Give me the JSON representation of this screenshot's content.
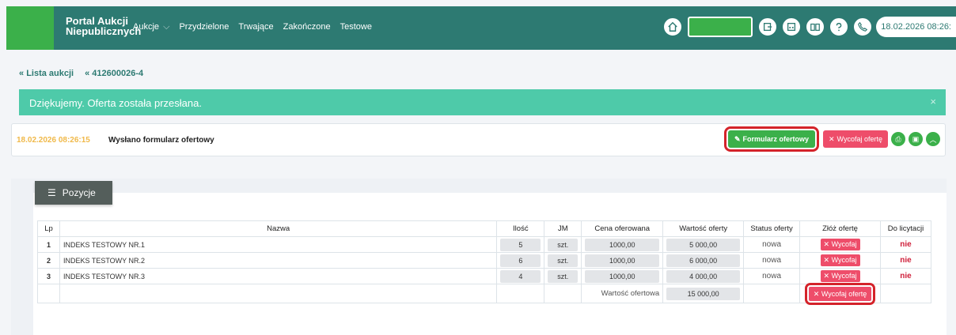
{
  "topbar": {
    "brand_line1": "Portal Aukcji",
    "brand_line2": "Niepublicznych",
    "nav": [
      {
        "label": "Aukcje",
        "has_dropdown": true
      },
      {
        "label": "Przydzielone"
      },
      {
        "label": "Trwające"
      },
      {
        "label": "Zakończone"
      },
      {
        "label": "Testowe"
      }
    ],
    "datetime": "18.02.2026 08:26:",
    "colors": {
      "bar": "#2d7a72",
      "brand_green": "#3bb04a"
    }
  },
  "breadcrumb": {
    "items": [
      "Lista aukcji",
      "412600026-4"
    ]
  },
  "alert": {
    "message": "Dziękujemy. Oferta została przesłana.",
    "close": "×"
  },
  "status": {
    "date": "18.02.2026 08:26:15",
    "message": "Wysłano formularz ofertowy",
    "form_button": "Formularz ofertowy",
    "withdraw_button": "Wycofaj ofertę"
  },
  "positions": {
    "tab_label": "Pozycje",
    "headers": [
      "Lp",
      "Nazwa",
      "Ilość",
      "JM",
      "Cena oferowana",
      "Wartość oferty",
      "Status oferty",
      "Złóż ofertę",
      "Do licytacji"
    ],
    "rows": [
      {
        "lp": "1",
        "name": "INDEKS TESTOWY NR.1",
        "qty": "5",
        "unit": "szt.",
        "price": "1000,00",
        "value": "5 000,00",
        "status": "nowa",
        "action": "Wycofaj",
        "bid": "nie"
      },
      {
        "lp": "2",
        "name": "INDEKS TESTOWY NR.2",
        "qty": "6",
        "unit": "szt.",
        "price": "1000,00",
        "value": "6 000,00",
        "status": "nowa",
        "action": "Wycofaj",
        "bid": "nie"
      },
      {
        "lp": "3",
        "name": "INDEKS TESTOWY NR.3",
        "qty": "4",
        "unit": "szt.",
        "price": "1000,00",
        "value": "4 000,00",
        "status": "nowa",
        "action": "Wycofaj",
        "bid": "nie"
      }
    ],
    "total_label": "Wartość ofertowa",
    "total_value": "15 000,00",
    "withdraw_all": "Wycofaj ofertę"
  }
}
